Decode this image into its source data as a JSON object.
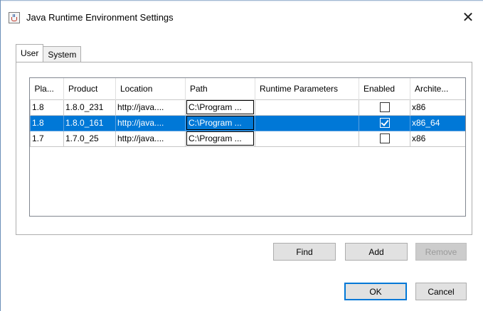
{
  "window": {
    "title": "Java Runtime Environment Settings"
  },
  "tabs": [
    {
      "label": "User",
      "active": true
    },
    {
      "label": "System",
      "active": false
    }
  ],
  "table": {
    "columns": [
      "Pla...",
      "Product",
      "Location",
      "Path",
      "Runtime Parameters",
      "Enabled",
      "Archite..."
    ],
    "rows": [
      {
        "platform": "1.8",
        "product": "1.8.0_231",
        "location": "http://java....",
        "path": "C:\\Program ...",
        "runtime_parameters": "",
        "enabled": false,
        "architecture": "x86",
        "selected": false
      },
      {
        "platform": "1.8",
        "product": "1.8.0_161",
        "location": "http://java....",
        "path": "C:\\Program ...",
        "runtime_parameters": "",
        "enabled": true,
        "architecture": "x86_64",
        "selected": true
      },
      {
        "platform": "1.7",
        "product": "1.7.0_25",
        "location": "http://java....",
        "path": "C:\\Program ...",
        "runtime_parameters": "",
        "enabled": false,
        "architecture": "x86",
        "selected": false
      }
    ]
  },
  "buttons": {
    "find": "Find",
    "add": "Add",
    "remove": "Remove",
    "ok": "OK",
    "cancel": "Cancel"
  },
  "colors": {
    "selection": "#0078d7",
    "button_face": "#e1e1e1",
    "disabled_text": "#9a9a9a"
  },
  "icons": {
    "title": "java-cup-icon",
    "close": "close-icon",
    "checkbox_checked": "checkmark-icon"
  }
}
